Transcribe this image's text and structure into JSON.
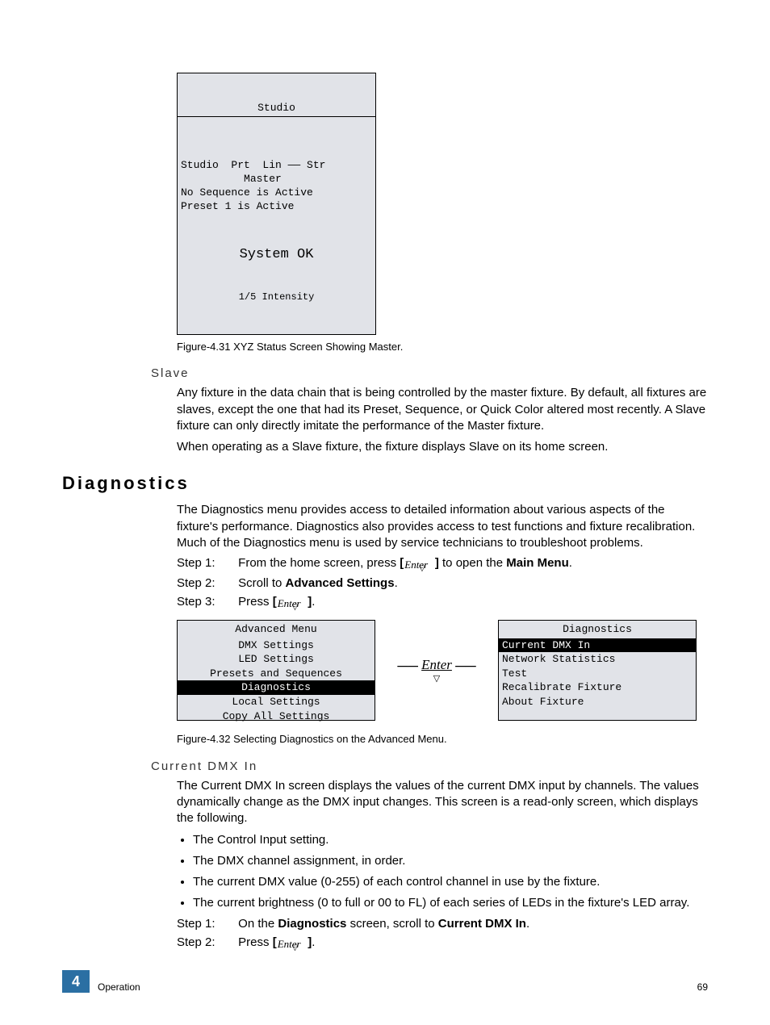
{
  "status_screen": {
    "title": "Studio",
    "line1": "Studio  Prt  Lin —— Str",
    "line2": "          Master",
    "line3": "No Sequence is Active",
    "line4": "Preset 1 is Active",
    "system": "System OK",
    "footer": "1/5 Intensity"
  },
  "fig431": "Figure-4.31 XYZ Status Screen Showing Master.",
  "slave": {
    "heading": "Slave",
    "p1": "Any fixture in the data chain that is being controlled by the master fixture. By default, all fixtures are slaves, except the one that had its Preset, Sequence, or Quick Color altered most recently. A Slave fixture can only directly imitate the performance of the Master fixture.",
    "p2": "When operating as a Slave fixture, the fixture displays Slave on its home screen."
  },
  "diagnostics": {
    "heading": "Diagnostics",
    "intro": "The Diagnostics menu provides access to detailed information about various aspects of the fixture's performance. Diagnostics also provides access to test functions and fixture recalibration. Much of the Diagnostics menu is used by service technicians to troubleshoot problems.",
    "steps": {
      "s1_pre": "From the home screen, press ",
      "s1_post": " to open the ",
      "s1_bold": "Main Menu",
      "s2": "Scroll to ",
      "s2_bold": "Advanced Settings",
      "s3": "Press "
    },
    "step_labels": {
      "s1": "Step 1:",
      "s2": "Step 2:",
      "s3": "Step 3:"
    }
  },
  "enter_label": "Enter",
  "menus": {
    "left": {
      "title": "Advanced Menu",
      "items": [
        "DMX Settings",
        "LED Settings",
        "Presets and Sequences",
        "Diagnostics",
        "Local Settings",
        "Copy All Settings"
      ],
      "highlight_index": 3
    },
    "between": "Enter",
    "right": {
      "title": "Diagnostics",
      "items": [
        "Current DMX In",
        "Network Statistics",
        "Test",
        "Recalibrate Fixture",
        "About Fixture"
      ],
      "highlight_index": 0
    }
  },
  "fig432": "Figure-4.32 Selecting Diagnostics on the Advanced Menu.",
  "current_dmx": {
    "heading": "Current DMX In",
    "intro": "The Current DMX In screen displays the values of the current DMX input by channels. The values dynamically change as the DMX input changes. This screen is a read-only screen, which displays the following.",
    "bullets": [
      "The Control Input setting.",
      "The DMX channel assignment, in order.",
      "The current DMX value (0-255) of each control channel in use by the fixture.",
      "The current brightness (0 to full or 00 to FL) of each series of LEDs in the fixture's LED array."
    ],
    "steps": {
      "labels": {
        "s1": "Step 1:",
        "s2": "Step 2:"
      },
      "s1_pre": "On the ",
      "s1_b1": "Diagnostics",
      "s1_mid": " screen, scroll to ",
      "s1_b2": "Current DMX In",
      "s2": "Press "
    }
  },
  "footer": {
    "chapter": "4",
    "section": "Operation",
    "page": "69"
  },
  "bracket_open": "[",
  "bracket_close": "]",
  "period": "."
}
